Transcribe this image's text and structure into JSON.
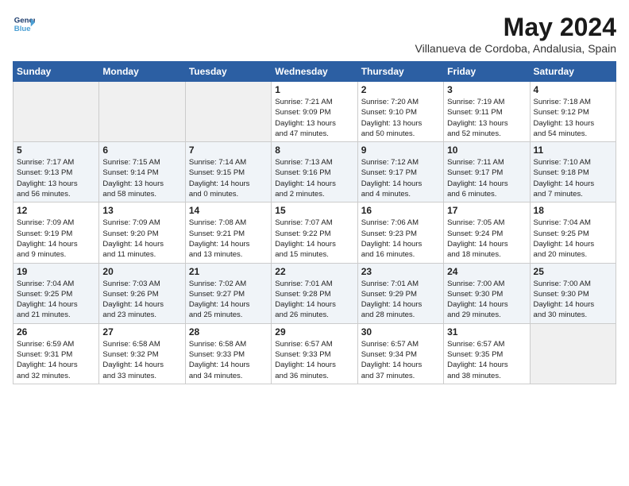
{
  "header": {
    "logo_line1": "General",
    "logo_line2": "Blue",
    "month": "May 2024",
    "location": "Villanueva de Cordoba, Andalusia, Spain"
  },
  "days_of_week": [
    "Sunday",
    "Monday",
    "Tuesday",
    "Wednesday",
    "Thursday",
    "Friday",
    "Saturday"
  ],
  "weeks": [
    [
      {
        "day": "",
        "info": ""
      },
      {
        "day": "",
        "info": ""
      },
      {
        "day": "",
        "info": ""
      },
      {
        "day": "1",
        "info": "Sunrise: 7:21 AM\nSunset: 9:09 PM\nDaylight: 13 hours\nand 47 minutes."
      },
      {
        "day": "2",
        "info": "Sunrise: 7:20 AM\nSunset: 9:10 PM\nDaylight: 13 hours\nand 50 minutes."
      },
      {
        "day": "3",
        "info": "Sunrise: 7:19 AM\nSunset: 9:11 PM\nDaylight: 13 hours\nand 52 minutes."
      },
      {
        "day": "4",
        "info": "Sunrise: 7:18 AM\nSunset: 9:12 PM\nDaylight: 13 hours\nand 54 minutes."
      }
    ],
    [
      {
        "day": "5",
        "info": "Sunrise: 7:17 AM\nSunset: 9:13 PM\nDaylight: 13 hours\nand 56 minutes."
      },
      {
        "day": "6",
        "info": "Sunrise: 7:15 AM\nSunset: 9:14 PM\nDaylight: 13 hours\nand 58 minutes."
      },
      {
        "day": "7",
        "info": "Sunrise: 7:14 AM\nSunset: 9:15 PM\nDaylight: 14 hours\nand 0 minutes."
      },
      {
        "day": "8",
        "info": "Sunrise: 7:13 AM\nSunset: 9:16 PM\nDaylight: 14 hours\nand 2 minutes."
      },
      {
        "day": "9",
        "info": "Sunrise: 7:12 AM\nSunset: 9:17 PM\nDaylight: 14 hours\nand 4 minutes."
      },
      {
        "day": "10",
        "info": "Sunrise: 7:11 AM\nSunset: 9:17 PM\nDaylight: 14 hours\nand 6 minutes."
      },
      {
        "day": "11",
        "info": "Sunrise: 7:10 AM\nSunset: 9:18 PM\nDaylight: 14 hours\nand 7 minutes."
      }
    ],
    [
      {
        "day": "12",
        "info": "Sunrise: 7:09 AM\nSunset: 9:19 PM\nDaylight: 14 hours\nand 9 minutes."
      },
      {
        "day": "13",
        "info": "Sunrise: 7:09 AM\nSunset: 9:20 PM\nDaylight: 14 hours\nand 11 minutes."
      },
      {
        "day": "14",
        "info": "Sunrise: 7:08 AM\nSunset: 9:21 PM\nDaylight: 14 hours\nand 13 minutes."
      },
      {
        "day": "15",
        "info": "Sunrise: 7:07 AM\nSunset: 9:22 PM\nDaylight: 14 hours\nand 15 minutes."
      },
      {
        "day": "16",
        "info": "Sunrise: 7:06 AM\nSunset: 9:23 PM\nDaylight: 14 hours\nand 16 minutes."
      },
      {
        "day": "17",
        "info": "Sunrise: 7:05 AM\nSunset: 9:24 PM\nDaylight: 14 hours\nand 18 minutes."
      },
      {
        "day": "18",
        "info": "Sunrise: 7:04 AM\nSunset: 9:25 PM\nDaylight: 14 hours\nand 20 minutes."
      }
    ],
    [
      {
        "day": "19",
        "info": "Sunrise: 7:04 AM\nSunset: 9:25 PM\nDaylight: 14 hours\nand 21 minutes."
      },
      {
        "day": "20",
        "info": "Sunrise: 7:03 AM\nSunset: 9:26 PM\nDaylight: 14 hours\nand 23 minutes."
      },
      {
        "day": "21",
        "info": "Sunrise: 7:02 AM\nSunset: 9:27 PM\nDaylight: 14 hours\nand 25 minutes."
      },
      {
        "day": "22",
        "info": "Sunrise: 7:01 AM\nSunset: 9:28 PM\nDaylight: 14 hours\nand 26 minutes."
      },
      {
        "day": "23",
        "info": "Sunrise: 7:01 AM\nSunset: 9:29 PM\nDaylight: 14 hours\nand 28 minutes."
      },
      {
        "day": "24",
        "info": "Sunrise: 7:00 AM\nSunset: 9:30 PM\nDaylight: 14 hours\nand 29 minutes."
      },
      {
        "day": "25",
        "info": "Sunrise: 7:00 AM\nSunset: 9:30 PM\nDaylight: 14 hours\nand 30 minutes."
      }
    ],
    [
      {
        "day": "26",
        "info": "Sunrise: 6:59 AM\nSunset: 9:31 PM\nDaylight: 14 hours\nand 32 minutes."
      },
      {
        "day": "27",
        "info": "Sunrise: 6:58 AM\nSunset: 9:32 PM\nDaylight: 14 hours\nand 33 minutes."
      },
      {
        "day": "28",
        "info": "Sunrise: 6:58 AM\nSunset: 9:33 PM\nDaylight: 14 hours\nand 34 minutes."
      },
      {
        "day": "29",
        "info": "Sunrise: 6:57 AM\nSunset: 9:33 PM\nDaylight: 14 hours\nand 36 minutes."
      },
      {
        "day": "30",
        "info": "Sunrise: 6:57 AM\nSunset: 9:34 PM\nDaylight: 14 hours\nand 37 minutes."
      },
      {
        "day": "31",
        "info": "Sunrise: 6:57 AM\nSunset: 9:35 PM\nDaylight: 14 hours\nand 38 minutes."
      },
      {
        "day": "",
        "info": ""
      }
    ]
  ]
}
